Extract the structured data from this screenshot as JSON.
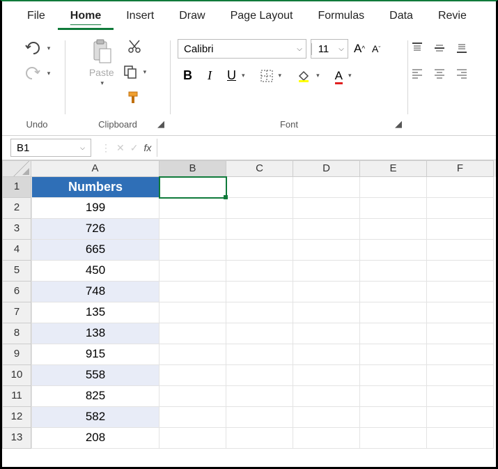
{
  "tabs": {
    "file": "File",
    "home": "Home",
    "insert": "Insert",
    "draw": "Draw",
    "page_layout": "Page Layout",
    "formulas": "Formulas",
    "data": "Data",
    "review": "Revie"
  },
  "ribbon": {
    "undo_label": "Undo",
    "clipboard_label": "Clipboard",
    "paste_label": "Paste",
    "font_label": "Font",
    "font_name": "Calibri",
    "font_size": "11",
    "bold": "B",
    "italic": "I",
    "underline": "U",
    "increase_font": "A",
    "decrease_font": "A"
  },
  "namebox": {
    "value": "B1",
    "fx": "fx"
  },
  "columns": [
    "A",
    "B",
    "C",
    "D",
    "E",
    "F"
  ],
  "rows": {
    "1": {
      "A": "Numbers"
    },
    "2": {
      "A": "199"
    },
    "3": {
      "A": "726"
    },
    "4": {
      "A": "665"
    },
    "5": {
      "A": "450"
    },
    "6": {
      "A": "748"
    },
    "7": {
      "A": "135"
    },
    "8": {
      "A": "138"
    },
    "9": {
      "A": "915"
    },
    "10": {
      "A": "558"
    },
    "11": {
      "A": "825"
    },
    "12": {
      "A": "582"
    },
    "13": {
      "A": "208"
    }
  }
}
